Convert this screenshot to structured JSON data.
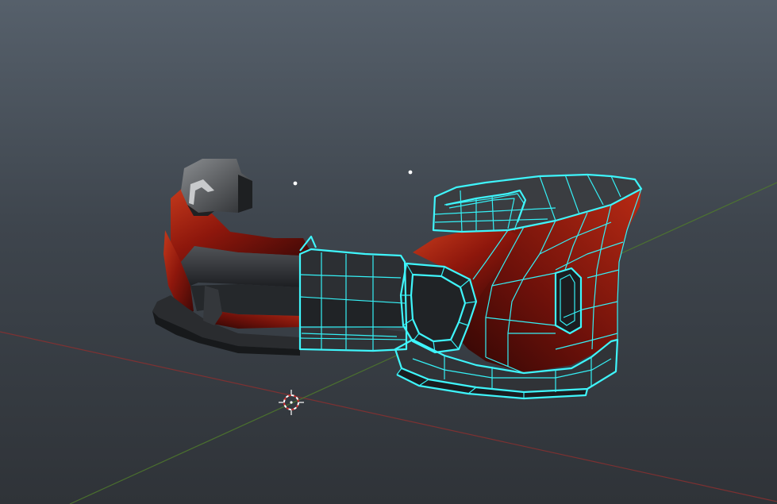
{
  "viewport": {
    "background_top": "#56606b",
    "background_bottom": "#2f3338",
    "x_axis_color": "#8a3030",
    "y_axis_color": "#4f7a2c"
  },
  "model": {
    "body_color": "#9e1d10",
    "trim_color": "#2a2d30",
    "selection_wire_color": "#35f0f5"
  },
  "icons": {
    "cursor": "3d-cursor-icon",
    "origin_points": "object-origin-icon"
  }
}
